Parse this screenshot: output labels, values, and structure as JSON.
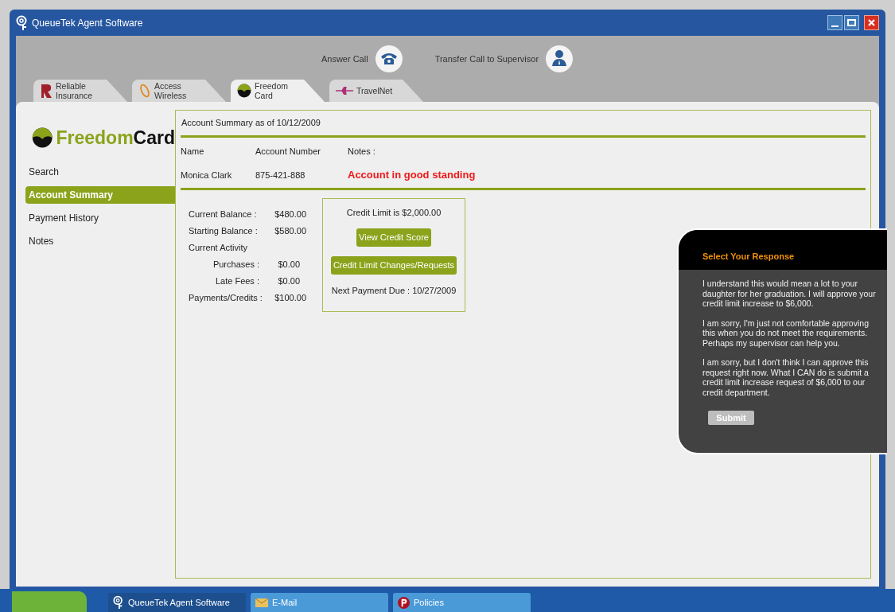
{
  "window": {
    "title": "QueueTek Agent Software"
  },
  "toolbar": [
    {
      "label": "Answer Call",
      "kind": "phone"
    },
    {
      "label": "Transfer Call to Supervisor",
      "kind": "person"
    }
  ],
  "tabs": [
    {
      "label": "Reliable Insurance",
      "kind": "reliable",
      "selected": false
    },
    {
      "label": "Access Wireless",
      "kind": "access",
      "selected": false
    },
    {
      "label": "Freedom Card",
      "kind": "freedom",
      "selected": true
    },
    {
      "label": "TravelNet",
      "kind": "travel",
      "selected": false
    }
  ],
  "logo": {
    "part_1": "Freedom",
    "part_2": "Card"
  },
  "sidebar": {
    "items": [
      {
        "label": "Search",
        "selected": false
      },
      {
        "label": "Account Summary",
        "selected": true
      },
      {
        "label": "Payment History",
        "selected": false
      },
      {
        "label": "Notes",
        "selected": false
      }
    ]
  },
  "summary": {
    "title": "Account Summary as of 10/12/2009",
    "columns": [
      "Name",
      "Account Number",
      "Notes :"
    ],
    "values": [
      "Monica Clark",
      "875-421-888",
      "Account in good standing"
    ]
  },
  "balances": [
    {
      "kind": "main",
      "label": "Current Balance :",
      "value": "$480.00"
    },
    {
      "kind": "main",
      "label": "Starting Balance :",
      "value": "$580.00"
    },
    {
      "kind": "heading",
      "label": "Current Activity"
    },
    {
      "kind": "sub",
      "label": "Purchases :",
      "value": "$0.00"
    },
    {
      "kind": "sub",
      "label": "Late Fees :",
      "value": "$0.00"
    },
    {
      "kind": "main",
      "label": "Payments/Credits :",
      "value": "$100.00"
    }
  ],
  "credit": {
    "limit": "Credit Limit is $2,000.00",
    "buttons": [
      "View Credit Score",
      "Credit Limit Changes/Requests"
    ],
    "next_payment": "Next Payment Due : 10/27/2009"
  },
  "response": {
    "title": "Select Your Response",
    "options": [
      "I understand this would mean a lot to your daughter for her graduation. I will approve your credit limit increase to $6,000.",
      "I am sorry, I'm just not comfortable approving this when you do not meet the requirements. Perhaps my supervisor can help you.",
      "I am sorry, but I don't think I can approve this request right now. What I CAN do is submit a credit limit increase request of $6,000 to our credit department."
    ],
    "submit": "Submit"
  },
  "taskbar": [
    {
      "label": "QueueTek Agent Software",
      "kind": "app",
      "selected": true
    },
    {
      "label": "E-Mail",
      "kind": "mail",
      "selected": false
    },
    {
      "label": "Policies",
      "kind": "policies",
      "selected": false
    }
  ]
}
